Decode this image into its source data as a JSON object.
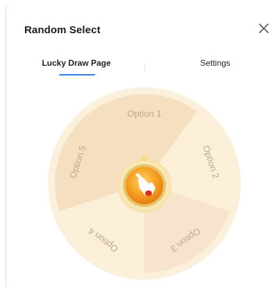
{
  "dialog": {
    "title": "Random Select",
    "close_icon": "close-icon"
  },
  "tabs": [
    {
      "label": "Lucky Draw Page",
      "active": true
    },
    {
      "label": "Settings",
      "active": false
    }
  ],
  "wheel": {
    "options": [
      "Option 1",
      "Option 2",
      "Option 3",
      "Option 4",
      "Option 5"
    ],
    "center_icon": "pointing-hand-icon",
    "colors": {
      "rim": "#fbf0dc",
      "segment_a": "#f5dfc0",
      "segment_b": "#fbefd7",
      "segment_c": "#f8e4cc",
      "label": "#bba88c",
      "button_orange": "#f39a1d",
      "tab_accent": "#2f7de1"
    }
  }
}
